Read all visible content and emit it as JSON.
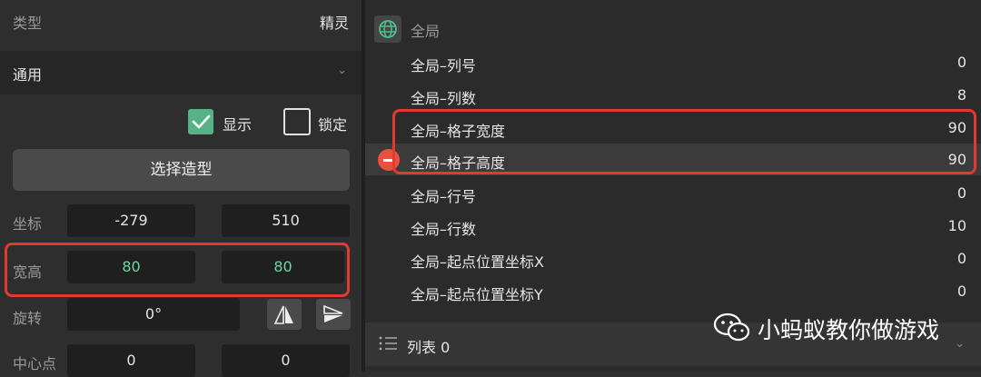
{
  "left_panel": {
    "type_label": "类型",
    "type_value": "精灵",
    "general_label": "通用",
    "show_label": "显示",
    "lock_label": "锁定",
    "choose_shape_button": "选择造型",
    "position_label": "坐标",
    "position_x": "-279",
    "position_y": "510",
    "size_label": "宽高",
    "width": "80",
    "height": "80",
    "rotation_label": "旋转",
    "rotation": "0°",
    "center_label": "中心点",
    "center_x": "0",
    "center_y": "0",
    "show_checked": true,
    "lock_checked": false
  },
  "right_panel": {
    "global_title": "全局",
    "variables": [
      {
        "name": "全局–列号",
        "value": "0"
      },
      {
        "name": "全局–列数",
        "value": "8"
      },
      {
        "name": "全局–格子宽度",
        "value": "90"
      },
      {
        "name": "全局–格子高度",
        "value": "90"
      },
      {
        "name": "全局–行号",
        "value": "0"
      },
      {
        "name": "全局–行数",
        "value": "10"
      },
      {
        "name": "全局–起点位置坐标X",
        "value": "0"
      },
      {
        "name": "全局–起点位置坐标Y",
        "value": "0"
      }
    ],
    "list_label": "列表 0"
  },
  "watermark": {
    "text": "小蚂蚁教你做游戏"
  },
  "colors": {
    "accent_green": "#58b287",
    "highlight_red": "#e23a2e",
    "value_green": "#6fd3a3"
  }
}
